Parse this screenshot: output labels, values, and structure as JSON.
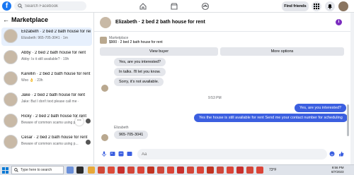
{
  "topbar": {
    "logo": "f",
    "search_placeholder": "Search Facebook",
    "find_friends": "Find friends"
  },
  "sidebar": {
    "heading": "Marketplace",
    "back_arrow": "←",
    "conversations": [
      {
        "name": "Elizabeth · 2 bed 2 bath house for rent",
        "sub": "Elizabeth: 965-705-3041 · 1m",
        "active": true
      },
      {
        "name": "Abby · 2 bed 2 bath house for rent",
        "sub": "Abby: Is it still available? · 19h"
      },
      {
        "name": "Karellin · 2 bed 2 bath house for rent",
        "sub": "Woo 👌 · 23h"
      },
      {
        "name": "Jake · 2 bed 2 bath house for rent",
        "sub": "Jake: But I don't text please call me · 1d"
      },
      {
        "name": "Ricky · 2 bed 2 bath house for rent",
        "sub": "Beware of common scams using p..."
      },
      {
        "name": "Cesar · 2 bed 2 bath house for rent",
        "sub": "Beware of common scams using p..."
      }
    ],
    "more_label": "···"
  },
  "chat": {
    "title": "Elizabeth · 2 bed 2 bath house for rent",
    "info_icon": "i",
    "listing": {
      "label": "Marketplace",
      "price": "$900 · 2 bed 2 bath house for rent",
      "view_buyer": "View buyer",
      "more_options": "More options"
    },
    "quick_replies": [
      "Yes, are you interested?",
      "In talks. I'll let you know.",
      "Sorry, it's not available."
    ],
    "timestamp": "9:53 PM",
    "outgoing": [
      "Yes, are you interested?",
      "Yes the house is still available for rent Send me your contact number for scheduling"
    ],
    "sender_name": "Elizabeth",
    "incoming": "965-705-3041",
    "composer_placeholder": "Aa"
  },
  "taskbar": {
    "search_placeholder": "Type here to search",
    "temperature": "73°F",
    "time": "9:56 PM",
    "date": "8/7/2023"
  },
  "colors": {
    "accent": "#1877f2",
    "outgoing_bubble": "#3b5fe0",
    "info_badge": "#7b2cbf"
  }
}
